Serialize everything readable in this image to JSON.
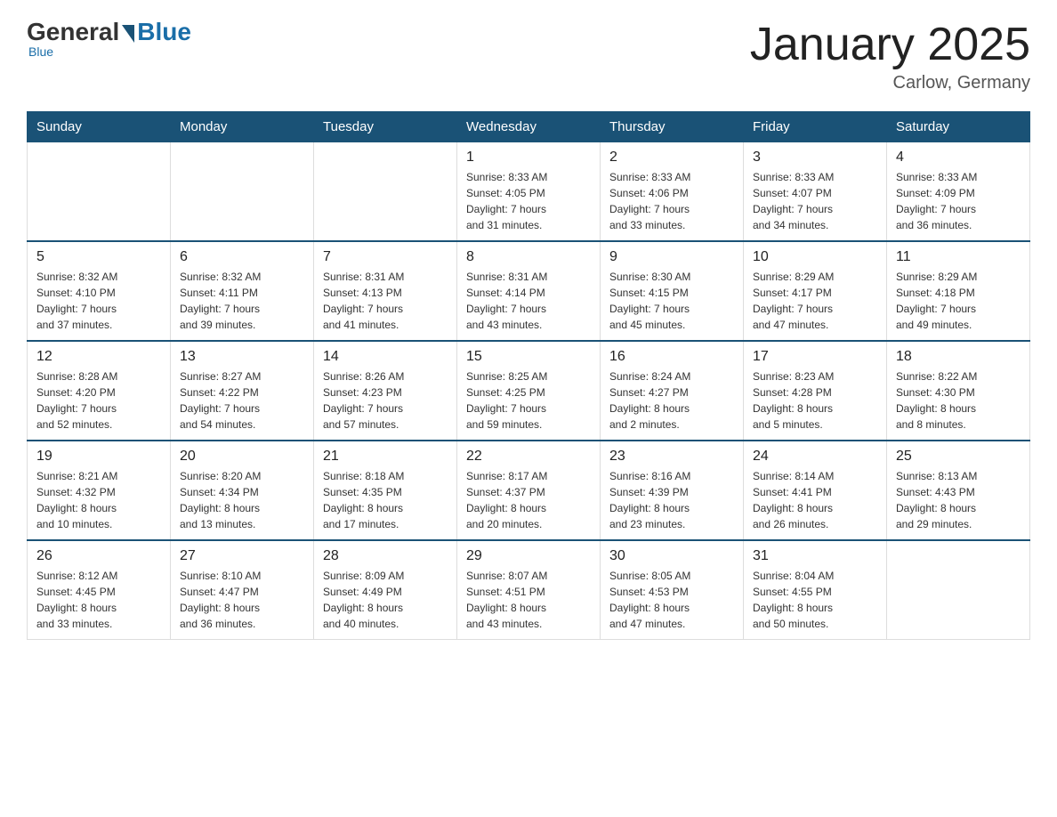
{
  "header": {
    "logo_general": "General",
    "logo_blue": "Blue",
    "title": "January 2025",
    "subtitle": "Carlow, Germany"
  },
  "days_of_week": [
    "Sunday",
    "Monday",
    "Tuesday",
    "Wednesday",
    "Thursday",
    "Friday",
    "Saturday"
  ],
  "weeks": [
    [
      {
        "day": "",
        "info": ""
      },
      {
        "day": "",
        "info": ""
      },
      {
        "day": "",
        "info": ""
      },
      {
        "day": "1",
        "info": "Sunrise: 8:33 AM\nSunset: 4:05 PM\nDaylight: 7 hours\nand 31 minutes."
      },
      {
        "day": "2",
        "info": "Sunrise: 8:33 AM\nSunset: 4:06 PM\nDaylight: 7 hours\nand 33 minutes."
      },
      {
        "day": "3",
        "info": "Sunrise: 8:33 AM\nSunset: 4:07 PM\nDaylight: 7 hours\nand 34 minutes."
      },
      {
        "day": "4",
        "info": "Sunrise: 8:33 AM\nSunset: 4:09 PM\nDaylight: 7 hours\nand 36 minutes."
      }
    ],
    [
      {
        "day": "5",
        "info": "Sunrise: 8:32 AM\nSunset: 4:10 PM\nDaylight: 7 hours\nand 37 minutes."
      },
      {
        "day": "6",
        "info": "Sunrise: 8:32 AM\nSunset: 4:11 PM\nDaylight: 7 hours\nand 39 minutes."
      },
      {
        "day": "7",
        "info": "Sunrise: 8:31 AM\nSunset: 4:13 PM\nDaylight: 7 hours\nand 41 minutes."
      },
      {
        "day": "8",
        "info": "Sunrise: 8:31 AM\nSunset: 4:14 PM\nDaylight: 7 hours\nand 43 minutes."
      },
      {
        "day": "9",
        "info": "Sunrise: 8:30 AM\nSunset: 4:15 PM\nDaylight: 7 hours\nand 45 minutes."
      },
      {
        "day": "10",
        "info": "Sunrise: 8:29 AM\nSunset: 4:17 PM\nDaylight: 7 hours\nand 47 minutes."
      },
      {
        "day": "11",
        "info": "Sunrise: 8:29 AM\nSunset: 4:18 PM\nDaylight: 7 hours\nand 49 minutes."
      }
    ],
    [
      {
        "day": "12",
        "info": "Sunrise: 8:28 AM\nSunset: 4:20 PM\nDaylight: 7 hours\nand 52 minutes."
      },
      {
        "day": "13",
        "info": "Sunrise: 8:27 AM\nSunset: 4:22 PM\nDaylight: 7 hours\nand 54 minutes."
      },
      {
        "day": "14",
        "info": "Sunrise: 8:26 AM\nSunset: 4:23 PM\nDaylight: 7 hours\nand 57 minutes."
      },
      {
        "day": "15",
        "info": "Sunrise: 8:25 AM\nSunset: 4:25 PM\nDaylight: 7 hours\nand 59 minutes."
      },
      {
        "day": "16",
        "info": "Sunrise: 8:24 AM\nSunset: 4:27 PM\nDaylight: 8 hours\nand 2 minutes."
      },
      {
        "day": "17",
        "info": "Sunrise: 8:23 AM\nSunset: 4:28 PM\nDaylight: 8 hours\nand 5 minutes."
      },
      {
        "day": "18",
        "info": "Sunrise: 8:22 AM\nSunset: 4:30 PM\nDaylight: 8 hours\nand 8 minutes."
      }
    ],
    [
      {
        "day": "19",
        "info": "Sunrise: 8:21 AM\nSunset: 4:32 PM\nDaylight: 8 hours\nand 10 minutes."
      },
      {
        "day": "20",
        "info": "Sunrise: 8:20 AM\nSunset: 4:34 PM\nDaylight: 8 hours\nand 13 minutes."
      },
      {
        "day": "21",
        "info": "Sunrise: 8:18 AM\nSunset: 4:35 PM\nDaylight: 8 hours\nand 17 minutes."
      },
      {
        "day": "22",
        "info": "Sunrise: 8:17 AM\nSunset: 4:37 PM\nDaylight: 8 hours\nand 20 minutes."
      },
      {
        "day": "23",
        "info": "Sunrise: 8:16 AM\nSunset: 4:39 PM\nDaylight: 8 hours\nand 23 minutes."
      },
      {
        "day": "24",
        "info": "Sunrise: 8:14 AM\nSunset: 4:41 PM\nDaylight: 8 hours\nand 26 minutes."
      },
      {
        "day": "25",
        "info": "Sunrise: 8:13 AM\nSunset: 4:43 PM\nDaylight: 8 hours\nand 29 minutes."
      }
    ],
    [
      {
        "day": "26",
        "info": "Sunrise: 8:12 AM\nSunset: 4:45 PM\nDaylight: 8 hours\nand 33 minutes."
      },
      {
        "day": "27",
        "info": "Sunrise: 8:10 AM\nSunset: 4:47 PM\nDaylight: 8 hours\nand 36 minutes."
      },
      {
        "day": "28",
        "info": "Sunrise: 8:09 AM\nSunset: 4:49 PM\nDaylight: 8 hours\nand 40 minutes."
      },
      {
        "day": "29",
        "info": "Sunrise: 8:07 AM\nSunset: 4:51 PM\nDaylight: 8 hours\nand 43 minutes."
      },
      {
        "day": "30",
        "info": "Sunrise: 8:05 AM\nSunset: 4:53 PM\nDaylight: 8 hours\nand 47 minutes."
      },
      {
        "day": "31",
        "info": "Sunrise: 8:04 AM\nSunset: 4:55 PM\nDaylight: 8 hours\nand 50 minutes."
      },
      {
        "day": "",
        "info": ""
      }
    ]
  ]
}
